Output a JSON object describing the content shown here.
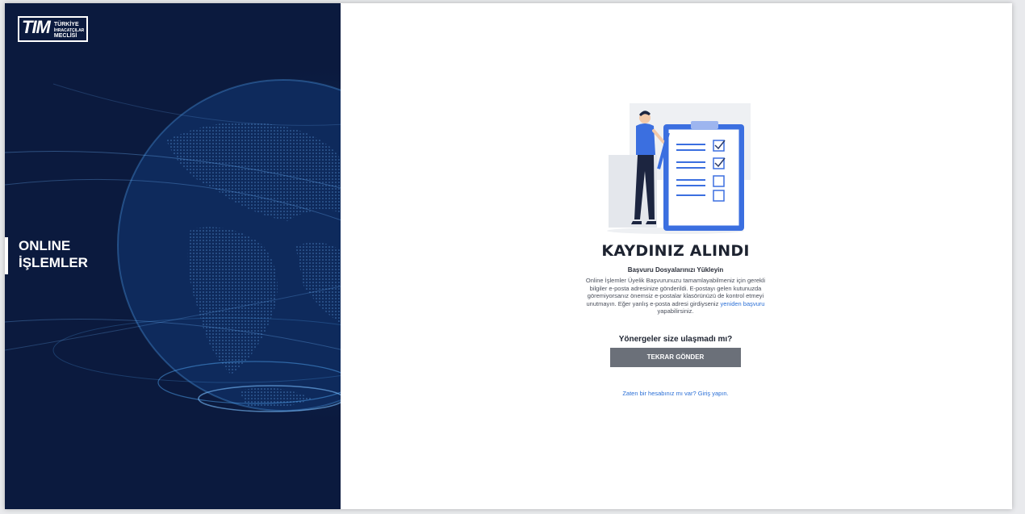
{
  "sidebar": {
    "logo": {
      "mark": "TIM",
      "line1": "TÜRKİYE",
      "line2": "İHRACATÇILAR",
      "line3": "MECLİSİ"
    },
    "heading_line1": "ONLINE",
    "heading_line2": "İŞLEMLER",
    "colors": {
      "background": "#0b1a3e",
      "globe": "#3a8fd8"
    }
  },
  "main": {
    "title": "KAYDINIZ ALINDI",
    "subtitle": "Başvuru Dosyalarınızı Yükleyin",
    "description_before": "Online İşlemler Üyelik Başvurunuzu tamamlayabilmeniz için gerekli bilgiler e-posta adresinize gönderildi. E-postayı gelen kutunuzda göremiyorsanız önemsiz e-postalar klasörünüzü de kontrol etmeyi unutmayın. Eğer yanlış e-posta adresi girdiyseniz",
    "description_link": "yeniden başvuru",
    "description_after": "yapabilirsiniz.",
    "resend_question": "Yönergeler size ulaşmadı mı?",
    "resend_button": "TEKRAR GÖNDER",
    "login_link": "Zaten bir hesabınız mı var? Giriş yapın.",
    "colors": {
      "button": "#6b7079",
      "link": "#2a6fd6",
      "accent": "#3b6fe0"
    }
  }
}
